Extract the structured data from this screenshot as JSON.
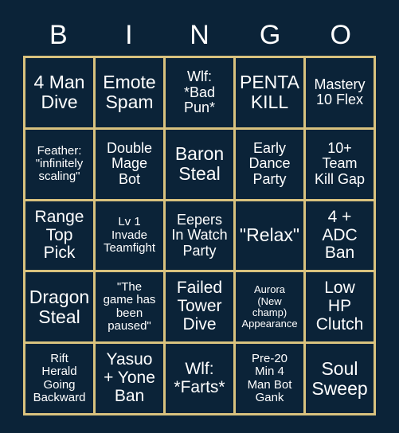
{
  "card": {
    "header_letters": [
      "B",
      "I",
      "N",
      "G",
      "O"
    ],
    "colors": {
      "background": "#0b2338",
      "grid_line": "#d9c27e",
      "cell_background": "#0b2338",
      "text": "#ffffff"
    },
    "rows": [
      [
        {
          "text": "4 Man\nDive",
          "size": "xl"
        },
        {
          "text": "Emote\nSpam",
          "size": "xl"
        },
        {
          "text": "Wlf:\n*Bad\nPun*",
          "size": "md"
        },
        {
          "text": "PENTA\nKILL",
          "size": "xl"
        },
        {
          "text": "Mastery\n10 Flex",
          "size": "md"
        }
      ],
      [
        {
          "text": "Feather:\n\"infinitely\nscaling\"",
          "size": "sm"
        },
        {
          "text": "Double\nMage\nBot",
          "size": "md"
        },
        {
          "text": "Baron\nSteal",
          "size": "xl"
        },
        {
          "text": "Early\nDance\nParty",
          "size": "md"
        },
        {
          "text": "10+\nTeam\nKill Gap",
          "size": "md"
        }
      ],
      [
        {
          "text": "Range\nTop\nPick",
          "size": "lg"
        },
        {
          "text": "Lv 1\nInvade\nTeamfight",
          "size": "sm"
        },
        {
          "text": "Eepers\nIn Watch\nParty",
          "size": "md"
        },
        {
          "text": "\"Relax\"",
          "size": "xl"
        },
        {
          "text": "4 +\nADC\nBan",
          "size": "lg"
        }
      ],
      [
        {
          "text": "Dragon\nSteal",
          "size": "xl"
        },
        {
          "text": "\"The\ngame has\nbeen\npaused\"",
          "size": "sm"
        },
        {
          "text": "Failed\nTower\nDive",
          "size": "lg"
        },
        {
          "text": "Aurora\n(New\nchamp)\nAppearance",
          "size": "xs"
        },
        {
          "text": "Low\nHP\nClutch",
          "size": "lg"
        }
      ],
      [
        {
          "text": "Rift\nHerald\nGoing\nBackward",
          "size": "sm"
        },
        {
          "text": "Yasuo\n+ Yone\nBan",
          "size": "lg"
        },
        {
          "text": "Wlf:\n*Farts*",
          "size": "lg"
        },
        {
          "text": "Pre-20\nMin 4\nMan Bot\nGank",
          "size": "sm"
        },
        {
          "text": "Soul\nSweep",
          "size": "xl"
        }
      ]
    ]
  }
}
